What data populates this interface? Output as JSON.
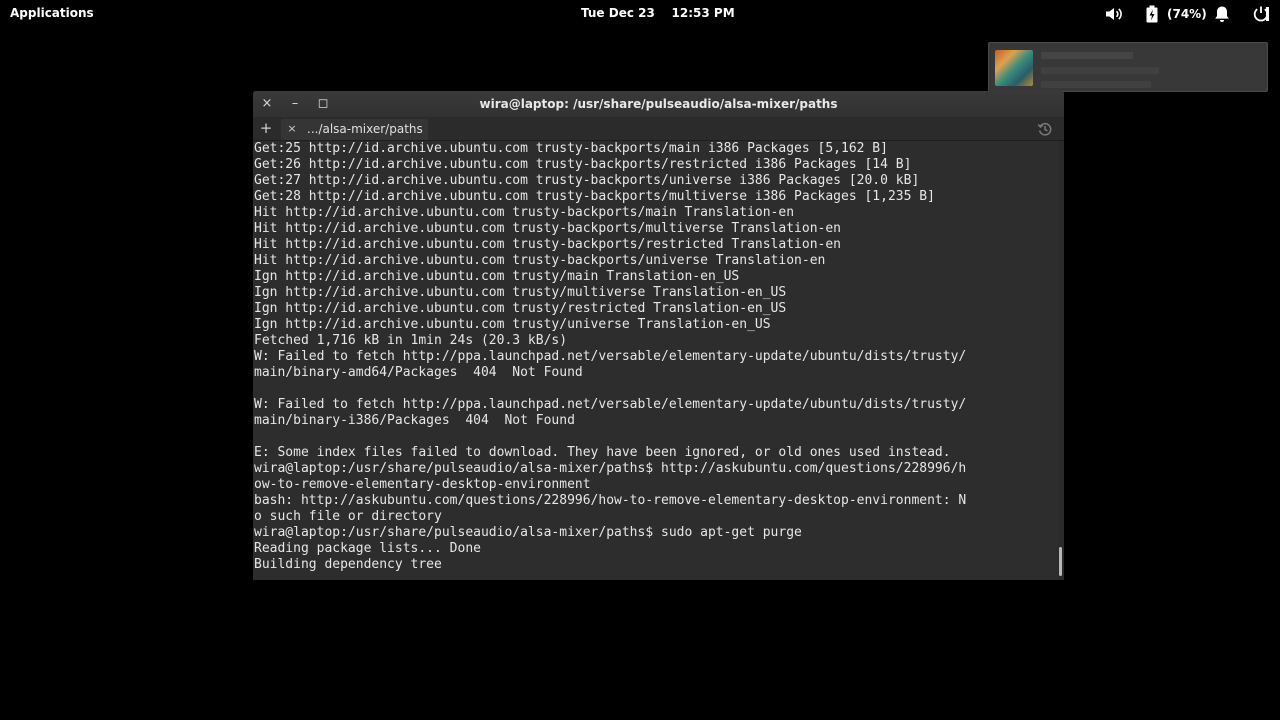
{
  "panel": {
    "applications_label": "Applications",
    "clock_day": "Tue Dec 23",
    "clock_time": "12:53 PM",
    "battery_percent": "(74%)",
    "icons": [
      "volume-icon",
      "battery-charging-icon",
      "bell-icon",
      "session-power-icon"
    ]
  },
  "window": {
    "title": "wira@laptop: /usr/share/pulseaudio/alsa-mixer/paths",
    "controls": {
      "close": "×",
      "minimize": "–",
      "maximize": "◻"
    }
  },
  "tabs": {
    "new_tab": "+",
    "close": "×",
    "items": [
      {
        "label": ".../alsa-mixer/paths"
      }
    ]
  },
  "terminal": {
    "lines": [
      "Get:25 http://id.archive.ubuntu.com trusty-backports/main i386 Packages [5,162 B]",
      "Get:26 http://id.archive.ubuntu.com trusty-backports/restricted i386 Packages [14 B]",
      "Get:27 http://id.archive.ubuntu.com trusty-backports/universe i386 Packages [20.0 kB]",
      "Get:28 http://id.archive.ubuntu.com trusty-backports/multiverse i386 Packages [1,235 B]",
      "Hit http://id.archive.ubuntu.com trusty-backports/main Translation-en",
      "Hit http://id.archive.ubuntu.com trusty-backports/multiverse Translation-en",
      "Hit http://id.archive.ubuntu.com trusty-backports/restricted Translation-en",
      "Hit http://id.archive.ubuntu.com trusty-backports/universe Translation-en",
      "Ign http://id.archive.ubuntu.com trusty/main Translation-en_US",
      "Ign http://id.archive.ubuntu.com trusty/multiverse Translation-en_US",
      "Ign http://id.archive.ubuntu.com trusty/restricted Translation-en_US",
      "Ign http://id.archive.ubuntu.com trusty/universe Translation-en_US",
      "Fetched 1,716 kB in 1min 24s (20.3 kB/s)",
      "W: Failed to fetch http://ppa.launchpad.net/versable/elementary-update/ubuntu/dists/trusty/",
      "main/binary-amd64/Packages  404  Not Found",
      "",
      "W: Failed to fetch http://ppa.launchpad.net/versable/elementary-update/ubuntu/dists/trusty/",
      "main/binary-i386/Packages  404  Not Found",
      "",
      "E: Some index files failed to download. They have been ignored, or old ones used instead.",
      "wira@laptop:/usr/share/pulseaudio/alsa-mixer/paths$ http://askubuntu.com/questions/228996/h",
      "ow-to-remove-elementary-desktop-environment",
      "bash: http://askubuntu.com/questions/228996/how-to-remove-elementary-desktop-environment: N",
      "o such file or directory",
      "wira@laptop:/usr/share/pulseaudio/alsa-mixer/paths$ sudo apt-get purge",
      "Reading package lists... Done",
      "Building dependency tree"
    ]
  },
  "notification": {
    "icon": "album-art-thumbnail"
  },
  "colors": {
    "terminal_bg": "#2d2d2d",
    "terminal_fg": "#e6e6e6",
    "panel_bg": "#000000",
    "desktop_bg": "#000000"
  }
}
